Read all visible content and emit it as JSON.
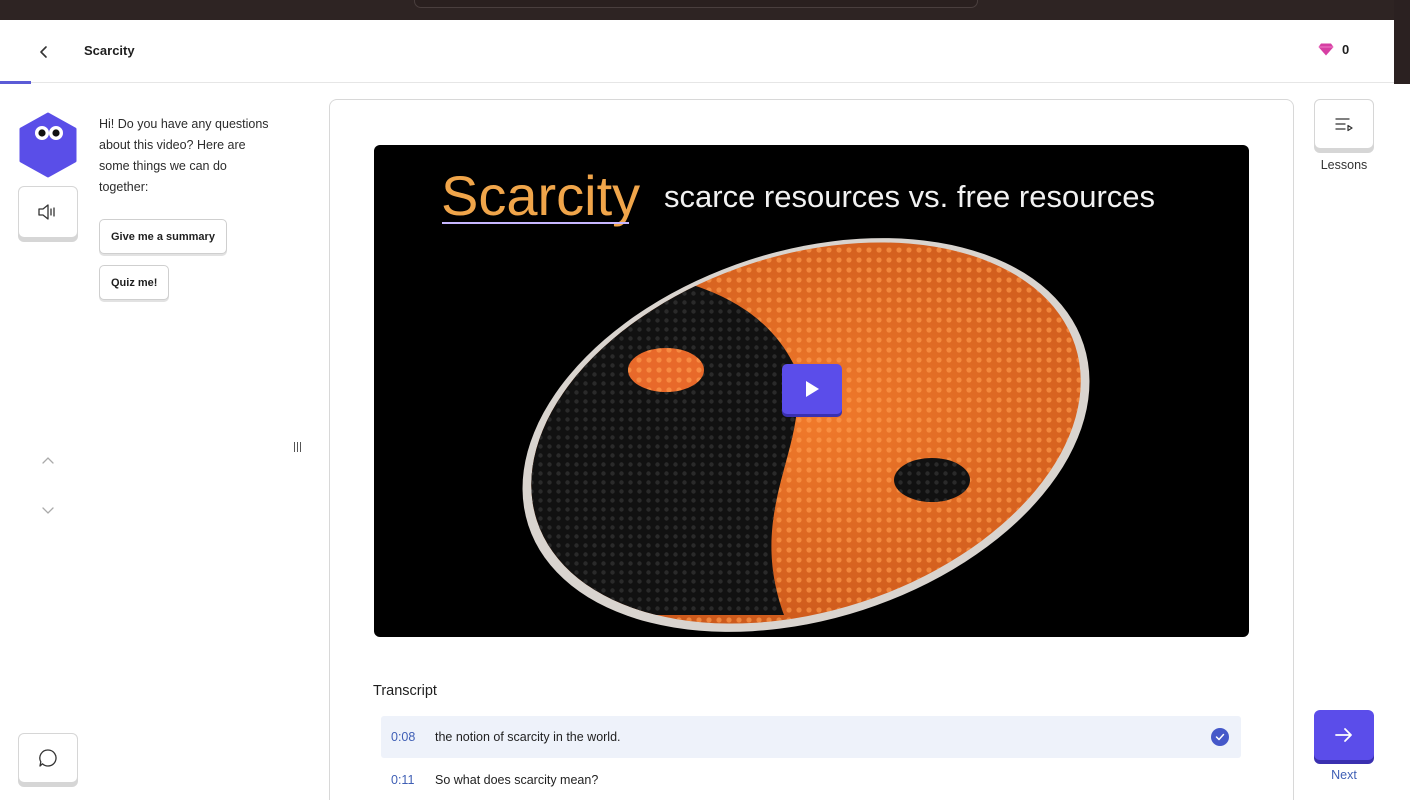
{
  "header": {
    "back_icon": "chevron-left-icon",
    "title": "Scarcity",
    "gems_icon": "gem-icon",
    "gems_count": "0",
    "progress_fraction": 0.022
  },
  "assistant": {
    "avatar_icon": "hexagon-mascot-icon",
    "sound_icon": "speaker-icon",
    "greeting": "Hi! Do you have any questions about this video? Here are some things we can do together:",
    "suggestions": [
      "Give me a summary",
      "Quiz me!"
    ],
    "scroll_up_icon": "chevron-up-icon",
    "scroll_down_icon": "chevron-down-icon",
    "chat_icon": "chat-bubble-icon"
  },
  "video": {
    "title": "Scarcity",
    "subtitle": "scarce resources vs. free resources",
    "play_icon": "play-icon"
  },
  "transcript": {
    "heading": "Transcript",
    "lines": [
      {
        "time": "0:08",
        "text": "the notion of scarcity in the world.",
        "active": true
      },
      {
        "time": "0:11",
        "text": "So what does scarcity mean?",
        "active": false
      }
    ]
  },
  "sidebar_right": {
    "lessons_icon": "playlist-icon",
    "lessons_label": "Lessons",
    "next_icon": "arrow-right-icon",
    "next_label": "Next"
  },
  "colors": {
    "accent": "#5b4dea",
    "link": "#3f5fb5",
    "gem": "#d63fa3",
    "title_orange": "#f0a54a"
  }
}
